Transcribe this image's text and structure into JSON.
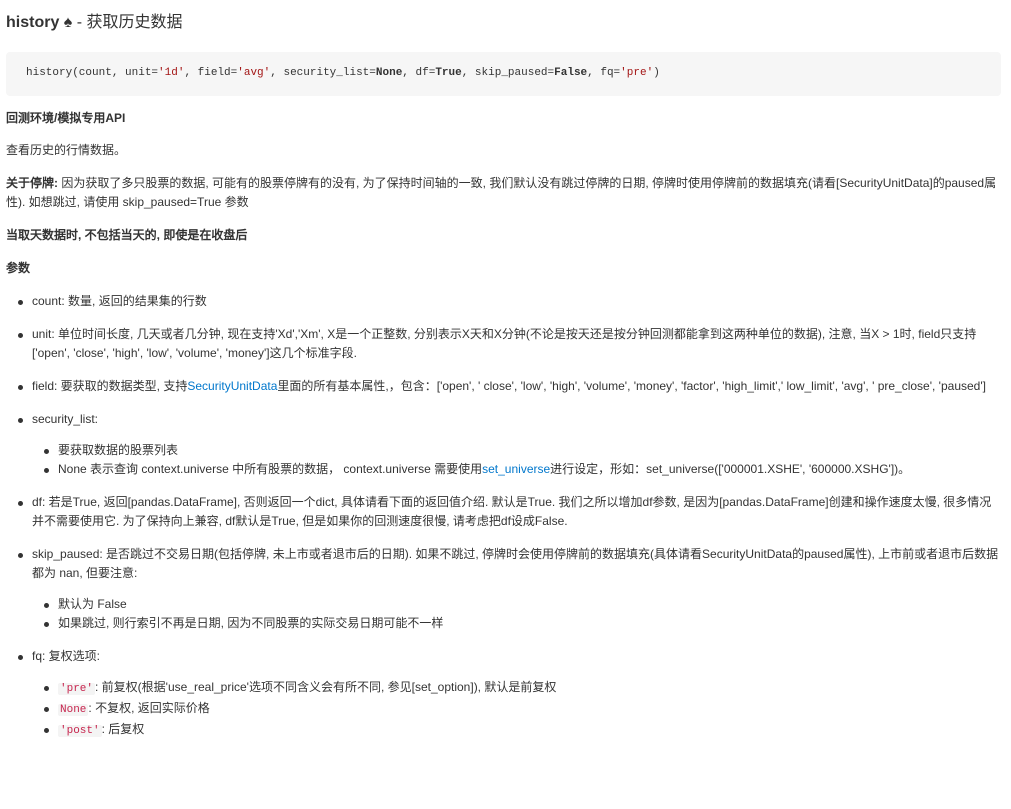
{
  "title": {
    "name": "history",
    "icon": "♠",
    "subtitle": "- 获取历史数据"
  },
  "code": {
    "fn": "history(count, unit=",
    "s1": "'1d'",
    "t2": ", field=",
    "s2": "'avg'",
    "t3": ", security_list=",
    "k1": "None",
    "t4": ", df=",
    "k2": "True",
    "t5": ", skip_paused=",
    "k3": "False",
    "t6": ", fq=",
    "s3": "'pre'",
    "t7": ")"
  },
  "env_heading": "回测环境/模拟专用API",
  "intro": "查看历史的行情数据。",
  "suspend": {
    "label": "关于停牌:",
    "text": " 因为获取了多只股票的数据, 可能有的股票停牌有的没有, 为了保持时间轴的一致, 我们默认没有跳过停牌的日期, 停牌时使用停牌前的数据填充(请看[SecurityUnitData]的paused属性). 如想跳过, 请使用 skip_paused=True 参数"
  },
  "note_today": "当取天数据时, 不包括当天的, 即使是在收盘后",
  "params_heading": "参数",
  "params": {
    "count": "count: 数量, 返回的结果集的行数",
    "unit": "unit: 单位时间长度, 几天或者几分钟, 现在支持'Xd','Xm', X是一个正整数, 分别表示X天和X分钟(不论是按天还是按分钟回测都能拿到这两种单位的数据), 注意, 当X > 1时, field只支持['open', 'close', 'high', 'low', 'volume', 'money']这几个标准字段.",
    "field_pre": "field: 要获取的数据类型, 支持",
    "field_link": "SecurityUnitData",
    "field_post": "里面的所有基本属性,，包含：['open', ' close', 'low', 'high', 'volume', 'money', 'factor', 'high_limit',' low_limit', 'avg', ' pre_close', 'paused']",
    "security_list": "security_list:",
    "security_sub1": "要获取数据的股票列表",
    "security_sub2_pre": "None 表示查询 context.universe 中所有股票的数据， context.universe 需要使用",
    "security_sub2_link": "set_universe",
    "security_sub2_post": "进行设定，形如：set_universe(['000001.XSHE', '600000.XSHG'])。",
    "df": "df: 若是True, 返回[pandas.DataFrame], 否则返回一个dict, 具体请看下面的返回值介绍. 默认是True. 我们之所以增加df参数, 是因为[pandas.DataFrame]创建和操作速度太慢, 很多情况并不需要使用它. 为了保持向上兼容, df默认是True, 但是如果你的回测速度很慢, 请考虑把df设成False.",
    "skip_paused": "skip_paused: 是否跳过不交易日期(包括停牌, 未上市或者退市后的日期). 如果不跳过, 停牌时会使用停牌前的数据填充(具体请看SecurityUnitData的paused属性), 上市前或者退市后数据都为 nan, 但要注意:",
    "skip_sub1": "默认为 False",
    "skip_sub2": "如果跳过, 则行索引不再是日期, 因为不同股票的实际交易日期可能不一样",
    "fq": "fq: 复权选项:",
    "fq_pre_code": "'pre'",
    "fq_pre_text": ": 前复权(根据'use_real_price'选项不同含义会有所不同, 参见[set_option]), 默认是前复权",
    "fq_none_code": "None",
    "fq_none_text": ": 不复权, 返回实际价格",
    "fq_post_code": "'post'",
    "fq_post_text": ": 后复权"
  }
}
